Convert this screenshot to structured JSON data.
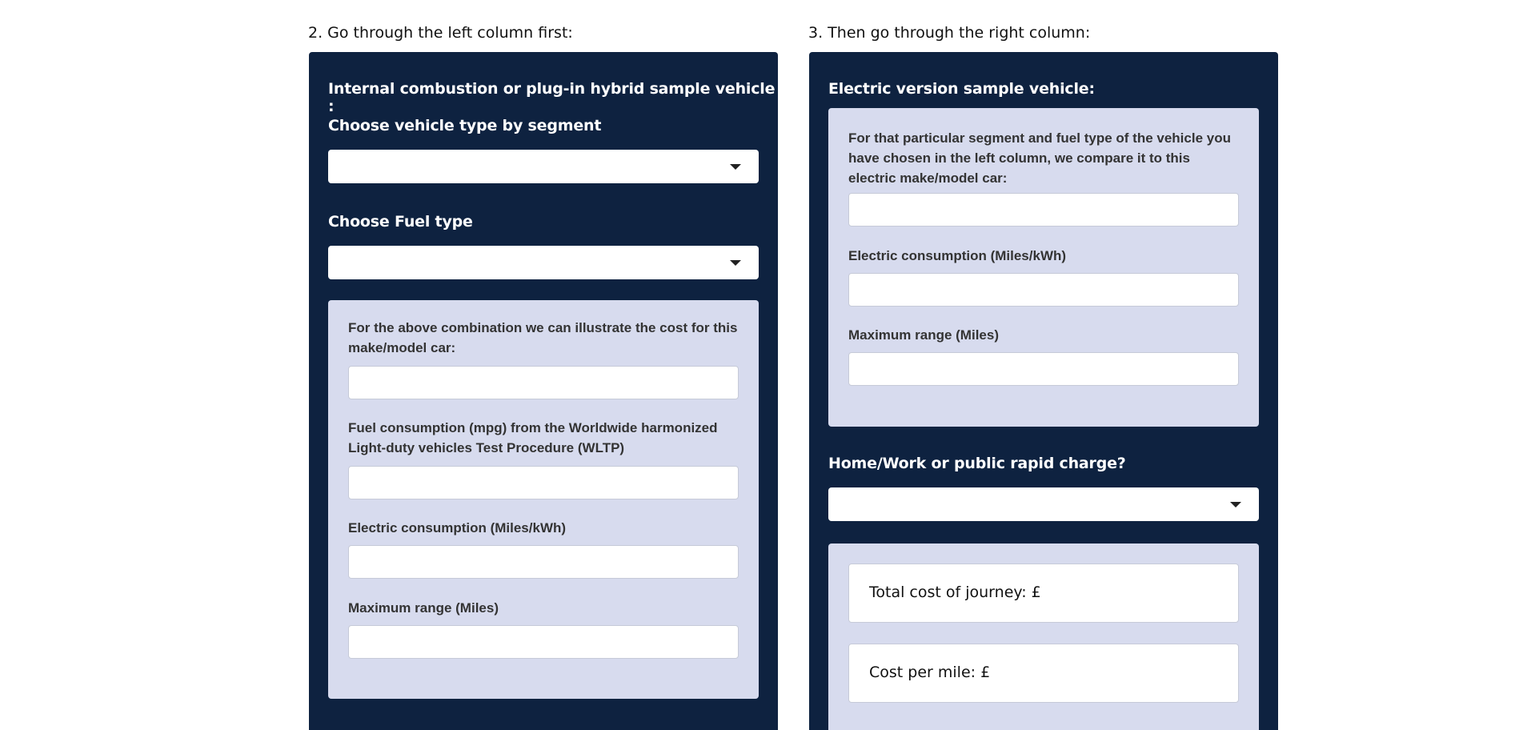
{
  "left_column": {
    "step_heading": "2. Go through the left column first:",
    "panel_title": "Internal combustion or plug-in hybrid sample vehicle :",
    "segment_label": "Choose vehicle type by segment",
    "segment_select_value": "",
    "fuel_label": "Choose Fuel type",
    "fuel_select_value": "",
    "details": {
      "intro_label": "For the above combination we can illustrate the cost for this make/model car:",
      "intro_value": "",
      "fuel_consumption_label": "Fuel consumption (mpg) from the Worldwide harmonized Light-duty vehicles Test Procedure (WLTP)",
      "fuel_consumption_value": "",
      "electric_consumption_label": "Electric consumption (Miles/kWh)",
      "electric_consumption_value": "",
      "max_range_label": "Maximum range (Miles)",
      "max_range_value": ""
    }
  },
  "right_column": {
    "step_heading": "3. Then go through the right column:",
    "panel_title": "Electric version sample vehicle:",
    "details": {
      "intro_label": "For that particular segment and fuel type of the vehicle you have chosen in the left column, we compare it to this electric make/model car:",
      "intro_value": "",
      "electric_consumption_label": "Electric consumption (Miles/kWh)",
      "electric_consumption_value": "",
      "max_range_label": "Maximum range (Miles)",
      "max_range_value": ""
    },
    "charge_label": "Home/Work or public rapid charge?",
    "charge_select_value": "",
    "results": {
      "total_cost_label": "Total cost of journey: £",
      "cost_per_mile_label": "Cost per mile: £"
    }
  },
  "colors": {
    "panel_background": "#0e2240",
    "well_background": "#d7dbee",
    "field_background": "#ffffff"
  },
  "icons": {
    "select_caret": "caret-down-icon"
  }
}
